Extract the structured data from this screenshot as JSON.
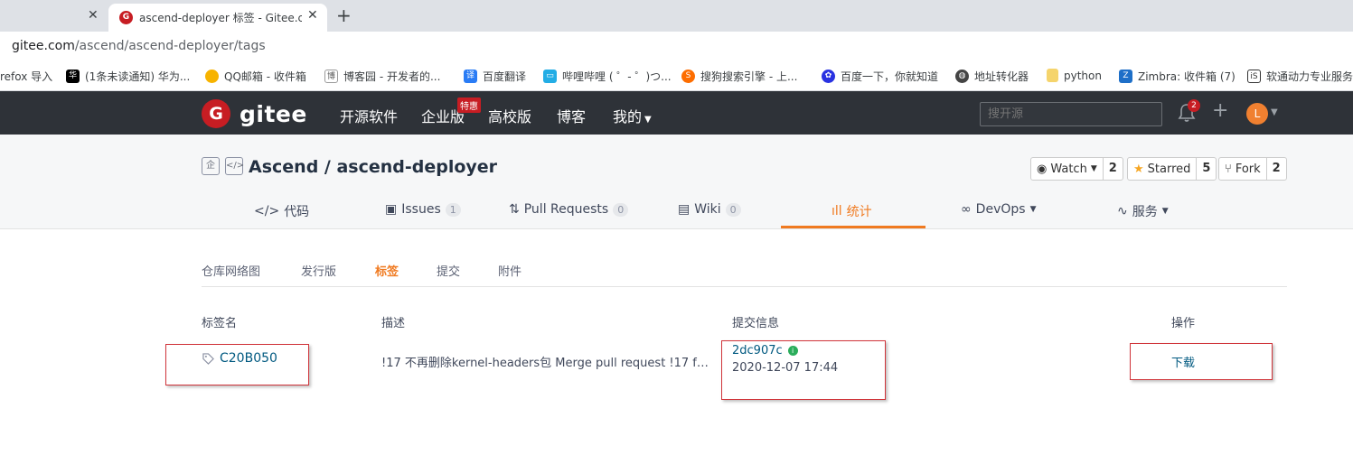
{
  "browser": {
    "active_tab_title": "ascend-deployer 标签 - Gitee.c",
    "url_host": "gitee.com",
    "url_path": "/ascend/ascend-deployer/tags",
    "bookmarks": [
      {
        "label": "refox 导入",
        "icon": "import-icon",
        "color": "#ffffff"
      },
      {
        "label": "(1条未读通知) 华为...",
        "icon": "huawei-icon",
        "color": "#000000"
      },
      {
        "label": "QQ邮箱 - 收件箱",
        "icon": "qqmail-icon",
        "color": "#f7b300"
      },
      {
        "label": "博客园 - 开发者的...",
        "icon": "cnblogs-icon",
        "color": "#555555"
      },
      {
        "label": "百度翻译",
        "icon": "translate-icon",
        "color": "#2a7cf5"
      },
      {
        "label": "哔哩哔哩 ( ゜- ゜)つ...",
        "icon": "bilibili-icon",
        "color": "#23ade5"
      },
      {
        "label": "搜狗搜索引擎 - 上...",
        "icon": "sogou-icon",
        "color": "#fd6d00"
      },
      {
        "label": "百度一下，你就知道",
        "icon": "baidu-icon",
        "color": "#2932e1"
      },
      {
        "label": "地址转化器",
        "icon": "globe-icon",
        "color": "#444444"
      },
      {
        "label": "python",
        "icon": "folder-icon",
        "color": "#f5d46c"
      },
      {
        "label": "Zimbra: 收件箱 (7)",
        "icon": "zimbra-icon",
        "color": "#1e6fc8"
      },
      {
        "label": "软通动力专业服务",
        "icon": "isoftstone-icon",
        "color": "#333333"
      }
    ]
  },
  "gitee": {
    "logo_text": "gitee",
    "logo_glyph": "G",
    "nav": [
      "开源软件",
      "企业版",
      "高校版",
      "博客",
      "我的"
    ],
    "promo_badge": "特惠",
    "search_placeholder": "搜开源",
    "notification_count": "2",
    "avatar_letter": "L",
    "colors": {
      "header_bg": "#2e3238",
      "brand": "#c71d23",
      "accent": "#f07a20",
      "link": "#005980"
    }
  },
  "repo": {
    "title": "Ascend / ascend-deployer",
    "watch_label": "Watch",
    "watch_count": "2",
    "star_label": "Starred",
    "star_count": "5",
    "fork_label": "Fork",
    "fork_count": "2",
    "tabs": [
      {
        "label": "代码",
        "count": null
      },
      {
        "label": "Issues",
        "count": "1"
      },
      {
        "label": "Pull Requests",
        "count": "0"
      },
      {
        "label": "Wiki",
        "count": "0"
      },
      {
        "label": "统计",
        "count": null
      },
      {
        "label": "DevOps",
        "count": null
      },
      {
        "label": "服务",
        "count": null
      }
    ]
  },
  "subnav": [
    "仓库网络图",
    "发行版",
    "标签",
    "提交",
    "附件"
  ],
  "table": {
    "headers": [
      "标签名",
      "描述",
      "提交信息",
      "操作"
    ],
    "rows": [
      {
        "tag": "C20B050",
        "description": "!17 不再删除kernel-headers包 Merge pull request !17 from ...",
        "commit_hash": "2dc907c",
        "commit_date": "2020-12-07 17:44",
        "action": "下载"
      }
    ]
  }
}
